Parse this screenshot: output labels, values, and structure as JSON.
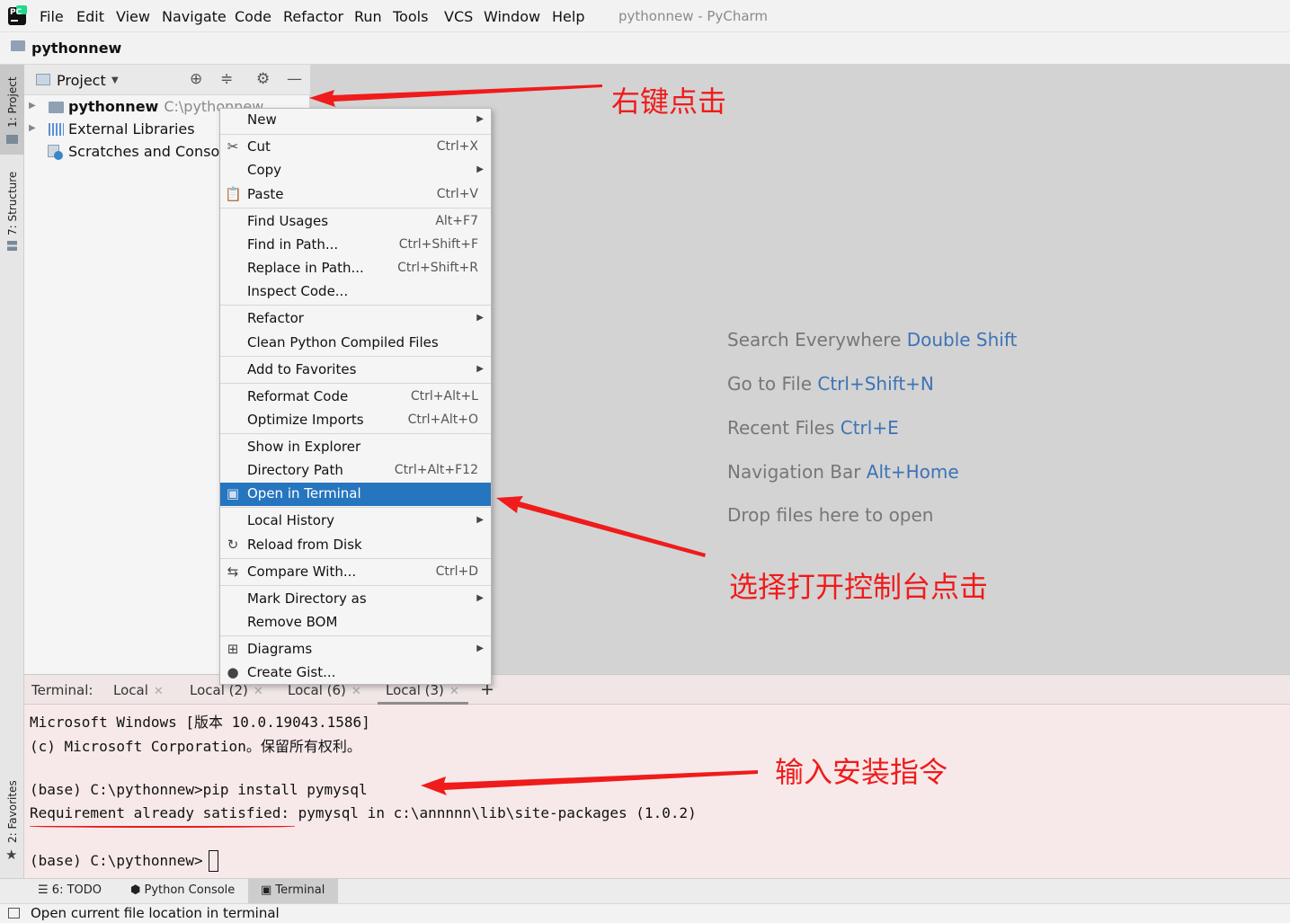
{
  "app": {
    "logo_text": "PC",
    "window_title": "pythonnew - PyCharm"
  },
  "menu": [
    "File",
    "Edit",
    "View",
    "Navigate",
    "Code",
    "Refactor",
    "Run",
    "Tools",
    "VCS",
    "Window",
    "Help"
  ],
  "breadcrumb": {
    "project": "pythonnew"
  },
  "tool_stripe": {
    "project": "1: Project",
    "structure": "7: Structure",
    "favorites": "2: Favorites"
  },
  "project_panel": {
    "title": "Project",
    "tree": [
      {
        "label": "pythonnew",
        "path": "C:\\pythonnew"
      },
      {
        "label": "External Libraries"
      },
      {
        "label": "Scratches and Consoles"
      }
    ]
  },
  "editor_hints": [
    {
      "text": "Search Everywhere",
      "key": "Double Shift"
    },
    {
      "text": "Go to File",
      "key": "Ctrl+Shift+N"
    },
    {
      "text": "Recent Files",
      "key": "Ctrl+E"
    },
    {
      "text": "Navigation Bar",
      "key": "Alt+Home"
    },
    {
      "text": "Drop files here to open",
      "key": ""
    }
  ],
  "context_menu": [
    {
      "label": "New",
      "shortcut": "",
      "submenu": true,
      "icon": ""
    },
    {
      "label": "Cut",
      "shortcut": "Ctrl+X",
      "submenu": false,
      "icon": "scissors-icon"
    },
    {
      "label": "Copy",
      "shortcut": "",
      "submenu": true,
      "icon": ""
    },
    {
      "label": "Paste",
      "shortcut": "Ctrl+V",
      "submenu": false,
      "icon": "clipboard-icon"
    },
    {
      "label": "Find Usages",
      "shortcut": "Alt+F7",
      "submenu": false,
      "icon": ""
    },
    {
      "label": "Find in Path...",
      "shortcut": "Ctrl+Shift+F",
      "submenu": false,
      "icon": ""
    },
    {
      "label": "Replace in Path...",
      "shortcut": "Ctrl+Shift+R",
      "submenu": false,
      "icon": ""
    },
    {
      "label": "Inspect Code...",
      "shortcut": "",
      "submenu": false,
      "icon": ""
    },
    {
      "label": "Refactor",
      "shortcut": "",
      "submenu": true,
      "icon": ""
    },
    {
      "label": "Clean Python Compiled Files",
      "shortcut": "",
      "submenu": false,
      "icon": ""
    },
    {
      "label": "Add to Favorites",
      "shortcut": "",
      "submenu": true,
      "icon": ""
    },
    {
      "label": "Reformat Code",
      "shortcut": "Ctrl+Alt+L",
      "submenu": false,
      "icon": ""
    },
    {
      "label": "Optimize Imports",
      "shortcut": "Ctrl+Alt+O",
      "submenu": false,
      "icon": ""
    },
    {
      "label": "Show in Explorer",
      "shortcut": "",
      "submenu": false,
      "icon": ""
    },
    {
      "label": "Directory Path",
      "shortcut": "Ctrl+Alt+F12",
      "submenu": false,
      "icon": ""
    },
    {
      "label": "Open in Terminal",
      "shortcut": "",
      "submenu": false,
      "icon": "terminal-icon",
      "selected": true
    },
    {
      "label": "Local History",
      "shortcut": "",
      "submenu": true,
      "icon": ""
    },
    {
      "label": "Reload from Disk",
      "shortcut": "",
      "submenu": false,
      "icon": "reload-icon"
    },
    {
      "label": "Compare With...",
      "shortcut": "Ctrl+D",
      "submenu": false,
      "icon": "compare-icon"
    },
    {
      "label": "Mark Directory as",
      "shortcut": "",
      "submenu": true,
      "icon": ""
    },
    {
      "label": "Remove BOM",
      "shortcut": "",
      "submenu": false,
      "icon": ""
    },
    {
      "label": "Diagrams",
      "shortcut": "",
      "submenu": true,
      "icon": "diagram-icon"
    },
    {
      "label": "Create Gist...",
      "shortcut": "",
      "submenu": false,
      "icon": "github-icon"
    }
  ],
  "annotations": {
    "right_click": "右键点击",
    "open_terminal": "选择打开控制台点击",
    "install_command": "输入安装指令",
    "color": "#f01b1b"
  },
  "terminal": {
    "label": "Terminal:",
    "tabs": [
      "Local",
      "Local (2)",
      "Local (6)",
      "Local (3)"
    ],
    "active_tab": "Local (3)",
    "lines": [
      "Microsoft Windows [版本 10.0.19043.1586]",
      "(c) Microsoft Corporation。保留所有权利。",
      "",
      "(base) C:\\pythonnew>pip install pymysql",
      "Requirement already satisfied: pymysql in c:\\annnnn\\lib\\site-packages (1.0.2)",
      "",
      "(base) C:\\pythonnew>"
    ]
  },
  "bottom_toolbar": {
    "todo": "6: TODO",
    "python_console": "Python Console",
    "terminal": "Terminal"
  },
  "status": {
    "text": "Open current file location in terminal"
  },
  "colors": {
    "selection": "#2675bf",
    "hint_key": "#3d73b5",
    "annotation": "#f01b1b"
  }
}
